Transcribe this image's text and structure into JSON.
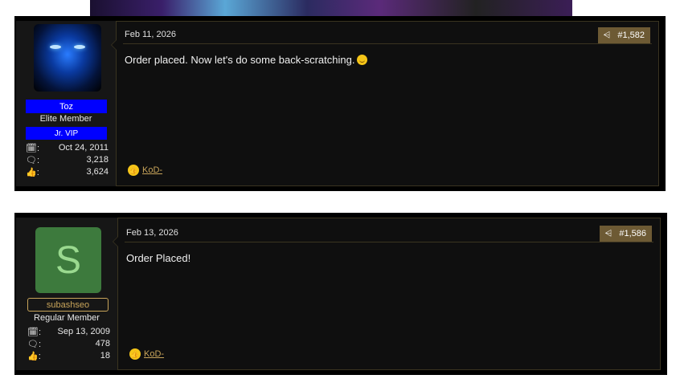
{
  "posts": [
    {
      "user": {
        "name": "Toz",
        "title": "Elite Member",
        "badge": "Jr. VIP",
        "joined": "Oct 24, 2011",
        "messages": "3,218",
        "reactions": "3,624"
      },
      "date": "Feb 11, 2026",
      "number": "#1,582",
      "text": "Order placed. Now let's do some back-scratching.",
      "reaction_user": "KoD-"
    },
    {
      "user": {
        "avatar_letter": "S",
        "name": "subashseo",
        "title": "Regular Member",
        "joined": "Sep 13, 2009",
        "messages": "478",
        "reactions": "18"
      },
      "date": "Feb 13, 2026",
      "number": "#1,586",
      "text": "Order Placed!",
      "reaction_user": "KoD-"
    }
  ],
  "icons": {
    "joined": "calendar-icon",
    "messages": "messages-icon",
    "reactions": "thumbs-up-icon",
    "share": "share-icon"
  },
  "colors": {
    "accent_gold": "#c8a45a",
    "share_bg": "#6d5a34",
    "vip_blue": "#0000ff",
    "avatar_green": "#3d7a3d"
  }
}
